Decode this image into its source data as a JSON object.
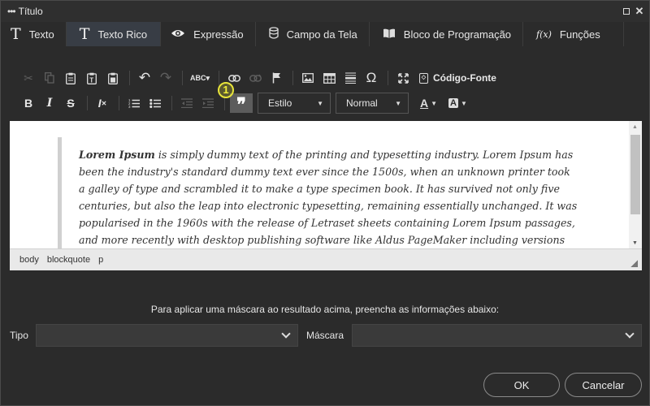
{
  "window": {
    "title": "Título"
  },
  "tabs": [
    {
      "label": "Texto",
      "icon": "text-icon"
    },
    {
      "label": "Texto Rico",
      "icon": "rich-text-icon"
    },
    {
      "label": "Expressão",
      "icon": "eye-icon"
    },
    {
      "label": "Campo da Tela",
      "icon": "database-icon"
    },
    {
      "label": "Bloco de Programação",
      "icon": "book-icon"
    },
    {
      "label": "Funções",
      "icon": "function-icon"
    }
  ],
  "toolbar": {
    "source_label": "Código-Fonte",
    "style_value": "Estilo",
    "format_value": "Normal",
    "highlight_number": "1"
  },
  "editor": {
    "bold_lead": "Lorem Ipsum",
    "body": " is simply dummy text of the printing and typesetting industry. Lorem Ipsum has been the industry's standard dummy text ever since the 1500s, when an unknown printer took a galley of type and scrambled it to make a type specimen book. It has survived not only five centuries, but also the leap into electronic typesetting, remaining essentially unchanged. It was popularised in the 1960s with the release of Letraset sheets containing Lorem Ipsum passages, and more recently with desktop publishing software like Aldus PageMaker including versions of Lorem Ipsum"
  },
  "path": [
    "body",
    "blockquote",
    "p"
  ],
  "mask": {
    "hint": "Para aplicar uma máscara ao resultado acima, preencha as informações abaixo:",
    "type_label": "Tipo",
    "mask_label": "Máscara",
    "type_value": "",
    "mask_value": ""
  },
  "buttons": {
    "ok": "OK",
    "cancel": "Cancelar"
  },
  "colors": {
    "background": "#2b2b2b",
    "active_tab": "#383d45",
    "highlight": "#e8e53a"
  }
}
